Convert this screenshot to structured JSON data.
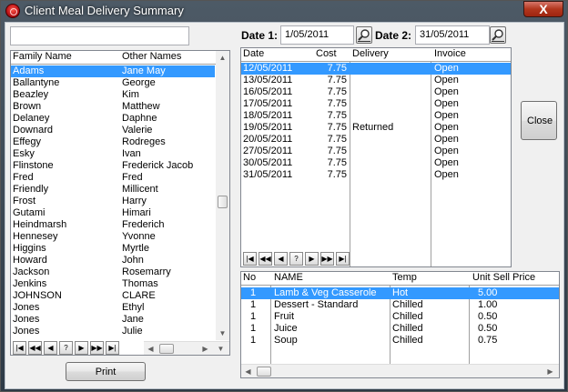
{
  "window": {
    "title": "Client Meal Delivery Summary",
    "close_glyph": "X"
  },
  "search": {
    "value": ""
  },
  "dates": {
    "label1": "Date 1:",
    "value1": "1/05/2011",
    "label2": "Date 2:",
    "value2": "31/05/2011"
  },
  "clients": {
    "columns": [
      "Family Name",
      "Other Names"
    ],
    "rows": [
      [
        "Adams",
        "Jane May"
      ],
      [
        "Ballantyne",
        "George"
      ],
      [
        "Beazley",
        "Kim"
      ],
      [
        "Brown",
        "Matthew"
      ],
      [
        "Delaney",
        "Daphne"
      ],
      [
        "Downard",
        "Valerie"
      ],
      [
        "Effegy",
        "Rodreges"
      ],
      [
        "Esky",
        "Ivan"
      ],
      [
        "Flinstone",
        "Frederick Jacob"
      ],
      [
        "Fred",
        "Fred"
      ],
      [
        "Friendly",
        "Millicent"
      ],
      [
        "Frost",
        "Harry"
      ],
      [
        "Gutami",
        "Himari"
      ],
      [
        "Heindmarsh",
        "Frederich"
      ],
      [
        "Hennesey",
        "Yvonne"
      ],
      [
        "Higgins",
        "Myrtle"
      ],
      [
        "Howard",
        "John"
      ],
      [
        "Jackson",
        "Rosemarry"
      ],
      [
        "Jenkins",
        "Thomas"
      ],
      [
        "JOHNSON",
        "CLARE"
      ],
      [
        "Jones",
        "Ethyl"
      ],
      [
        "Jones",
        "Jane"
      ],
      [
        "Jones",
        "Julie"
      ]
    ],
    "selected_index": 0
  },
  "deliveries": {
    "columns": [
      "Date",
      "Cost",
      "Delivery",
      "Invoice"
    ],
    "rows": [
      [
        "12/05/2011",
        "7.75",
        "",
        "Open"
      ],
      [
        "13/05/2011",
        "7.75",
        "",
        "Open"
      ],
      [
        "16/05/2011",
        "7.75",
        "",
        "Open"
      ],
      [
        "17/05/2011",
        "7.75",
        "",
        "Open"
      ],
      [
        "18/05/2011",
        "7.75",
        "",
        "Open"
      ],
      [
        "19/05/2011",
        "7.75",
        "Returned",
        "Open"
      ],
      [
        "20/05/2011",
        "7.75",
        "",
        "Open"
      ],
      [
        "27/05/2011",
        "7.75",
        "",
        "Open"
      ],
      [
        "30/05/2011",
        "7.75",
        "",
        "Open"
      ],
      [
        "31/05/2011",
        "7.75",
        "",
        "Open"
      ]
    ],
    "selected_index": 0
  },
  "items": {
    "columns": [
      "No",
      "NAME",
      "Temp",
      "Unit Sell Price"
    ],
    "rows": [
      [
        "1",
        "Lamb & Veg Casserole",
        "Hot",
        "5.00"
      ],
      [
        "1",
        "Dessert - Standard",
        "Chilled",
        "1.00"
      ],
      [
        "1",
        "Fruit",
        "Chilled",
        "0.50"
      ],
      [
        "1",
        "Juice",
        "Chilled",
        "0.50"
      ],
      [
        "1",
        "Soup",
        "Chilled",
        "0.75"
      ]
    ],
    "selected_index": 0
  },
  "nav": [
    "|◀",
    "◀◀",
    "◀",
    "?",
    "▶",
    "▶▶",
    "▶|"
  ],
  "buttons": {
    "print": "Print",
    "close": "Close"
  }
}
